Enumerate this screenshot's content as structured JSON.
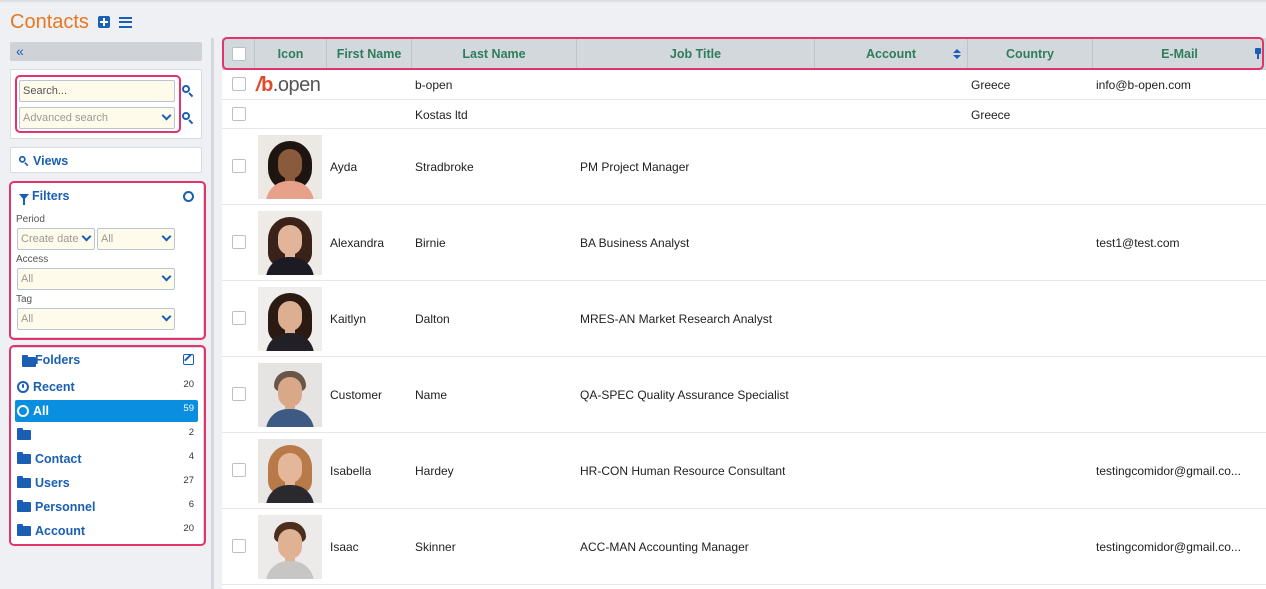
{
  "header": {
    "title": "Contacts",
    "add_icon": "plus-square-icon",
    "menu_icon": "hamburger-icon"
  },
  "sidebar": {
    "collapse_label": "«",
    "search": {
      "placeholder": "Search...",
      "advanced_placeholder": "Advanced search"
    },
    "views_label": "Views",
    "filters": {
      "title": "Filters",
      "period_label": "Period",
      "period_value": "Create date",
      "period_range": "All",
      "access_label": "Access",
      "access_value": "All",
      "tag_label": "Tag",
      "tag_value": "All"
    },
    "folders": {
      "title": "Folders",
      "items": [
        {
          "label": "Recent",
          "count": "20",
          "icon": "clock-icon"
        },
        {
          "label": "All",
          "count": "59",
          "icon": "circle-icon",
          "active": true
        },
        {
          "label": "",
          "count": "2",
          "icon": "folder-icon"
        },
        {
          "label": "Contact",
          "count": "4",
          "icon": "folder-icon"
        },
        {
          "label": "Users",
          "count": "27",
          "icon": "folder-icon"
        },
        {
          "label": "Personnel",
          "count": "6",
          "icon": "folder-icon"
        },
        {
          "label": "Account",
          "count": "20",
          "icon": "folder-icon"
        }
      ]
    }
  },
  "grid": {
    "columns": [
      "Icon",
      "First Name",
      "Last Name",
      "Job Title",
      "Account",
      "Country",
      "E-Mail"
    ],
    "rows": [
      {
        "icon": "logo",
        "logo_text": "b.open",
        "first": "",
        "last": "b-open",
        "job": "",
        "account": "",
        "country": "Greece",
        "email": "info@b-open.com"
      },
      {
        "icon": "none",
        "first": "",
        "last": "Kostas ltd",
        "job": "",
        "account": "",
        "country": "Greece",
        "email": ""
      },
      {
        "icon": "photo",
        "first": "Ayda",
        "last": "Stradbroke",
        "job": "PM Project Manager",
        "account": "",
        "country": "",
        "email": ""
      },
      {
        "icon": "photo",
        "first": "Alexandra",
        "last": "Birnie",
        "job": "BA Business Analyst",
        "account": "",
        "country": "",
        "email": "test1@test.com"
      },
      {
        "icon": "photo",
        "first": "Kaitlyn",
        "last": "Dalton",
        "job": "MRES-AN Market Research Analyst",
        "account": "",
        "country": "",
        "email": ""
      },
      {
        "icon": "photo",
        "first": "Customer",
        "last": "Name",
        "job": "QA-SPEC Quality Assurance Specialist",
        "account": "",
        "country": "",
        "email": ""
      },
      {
        "icon": "photo",
        "first": "Isabella",
        "last": "Hardey",
        "job": "HR-CON Human Resource Consultant",
        "account": "",
        "country": "",
        "email": "testingcomidor@gmail.co..."
      },
      {
        "icon": "photo",
        "first": "Isaac",
        "last": "Skinner",
        "job": "ACC-MAN Accounting Manager",
        "account": "",
        "country": "",
        "email": "testingcomidor@gmail.co..."
      }
    ]
  },
  "colors": {
    "accent": "#1a5fb4",
    "title": "#e87722",
    "highlight": "#e3336b",
    "active_folder": "#0a8fe0",
    "column_header_text": "#2e7d5c"
  }
}
